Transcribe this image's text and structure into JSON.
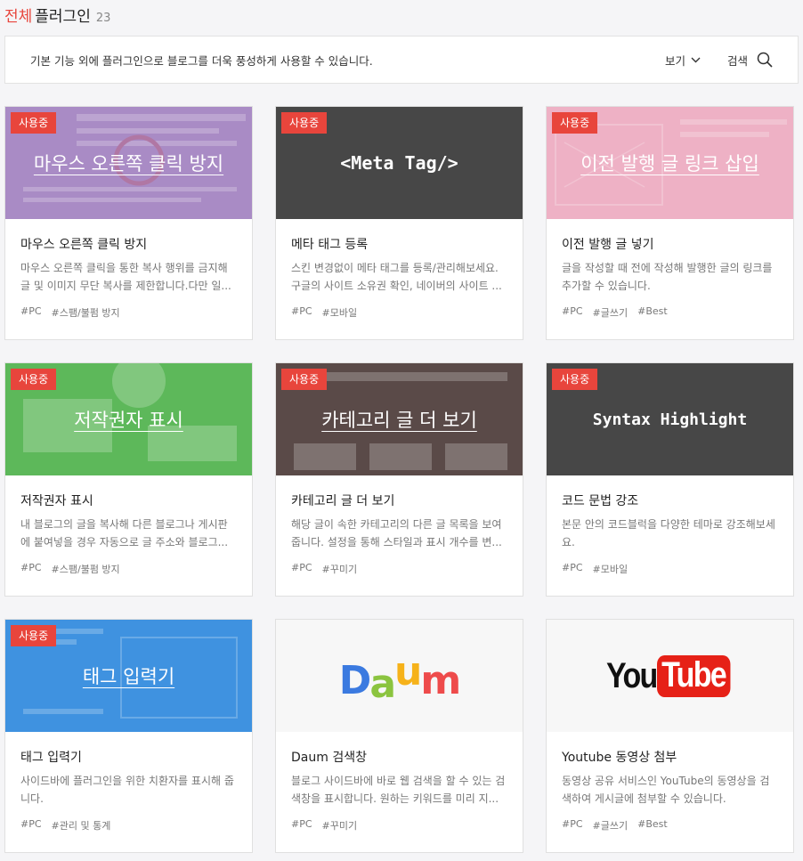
{
  "header": {
    "accent": "전체",
    "title": "플러그인",
    "count": "23"
  },
  "infobar": {
    "description": "기본 기능 외에 플러그인으로 블로그를 더욱 풍성하게 사용할 수 있습니다.",
    "view_label": "보기",
    "search_label": "검색"
  },
  "cards": [
    {
      "badge": "사용중",
      "thumb_title": "마우스 오른쪽 클릭 방지",
      "name": "마우스 오른쪽 클릭 방지",
      "summary": "마우스 오른쪽 클릭을 통한 복사 행위를 금지해 글 및 이미지 무단 복사를 제한합니다.다만 일...",
      "tags": [
        "#PC",
        "#스팸/불펌 방지"
      ]
    },
    {
      "badge": "사용중",
      "thumb_title": "<Meta Tag/>",
      "name": "메타 태그 등록",
      "summary": "스킨 변경없이 메타 태그를 등록/관리해보세요. 구글의 사이트 소유권 확인, 네이버의 사이트 ...",
      "tags": [
        "#PC",
        "#모바일"
      ]
    },
    {
      "badge": "사용중",
      "thumb_title": "이전 발행 글 링크 삽입",
      "name": "이전 발행 글 넣기",
      "summary": "글을 작성할 때 전에 작성해 발행한 글의 링크를 추가할 수 있습니다.",
      "tags": [
        "#PC",
        "#글쓰기",
        "#Best"
      ]
    },
    {
      "badge": "사용중",
      "thumb_title": "저작권자 표시",
      "name": "저작권자 표시",
      "summary": "내 블로그의 글을 복사해 다른 블로그나 게시판에 붙여넣을 경우 자동으로 글 주소와 블로그...",
      "tags": [
        "#PC",
        "#스팸/불펌 방지"
      ]
    },
    {
      "badge": "사용중",
      "thumb_title": "카테고리 글 더 보기",
      "name": "카테고리 글 더 보기",
      "summary": "해당 글이 속한 카테고리의 다른 글 목록을 보여줍니다. 설정을 통해 스타일과 표시 개수를 변...",
      "tags": [
        "#PC",
        "#꾸미기"
      ]
    },
    {
      "badge": "사용중",
      "thumb_title": "Syntax Highlight",
      "name": "코드 문법 강조",
      "summary": "본문 안의 코드블럭을 다양한 테마로 강조해보세요.",
      "tags": [
        "#PC",
        "#모바일"
      ]
    },
    {
      "badge": "사용중",
      "thumb_title": "태그 입력기",
      "name": "태그 입력기",
      "summary": "사이드바에 플러그인을 위한 치환자를 표시해 줍니다.",
      "tags": [
        "#PC",
        "#관리 및 통계"
      ]
    },
    {
      "badge": "",
      "thumb_title": "Daum",
      "name": "Daum 검색창",
      "summary": "블로그 사이드바에 바로 웹 검색을 할 수 있는 검색창을 표시합니다. 원하는 키워드를 미리 지...",
      "tags": [
        "#PC",
        "#꾸미기"
      ]
    },
    {
      "badge": "",
      "thumb_title": "YouTube",
      "name": "Youtube 동영상 첨부",
      "summary": "동영상 공유 서비스인 YouTube의 동영상을 검색하여 게시글에 첨부할 수 있습니다.",
      "tags": [
        "#PC",
        "#글쓰기",
        "#Best"
      ]
    }
  ],
  "logos": {
    "daum_letters": [
      "D",
      "a",
      "u",
      "m"
    ],
    "yt_you": "You",
    "yt_tube": "Tube"
  },
  "colors": {
    "accent": "#e8453c",
    "purple": "#a98bc5",
    "dark": "#474747",
    "pink": "#eeb1c5",
    "green": "#5db85a",
    "brown": "#5a4a48",
    "blue": "#3f92e0"
  }
}
